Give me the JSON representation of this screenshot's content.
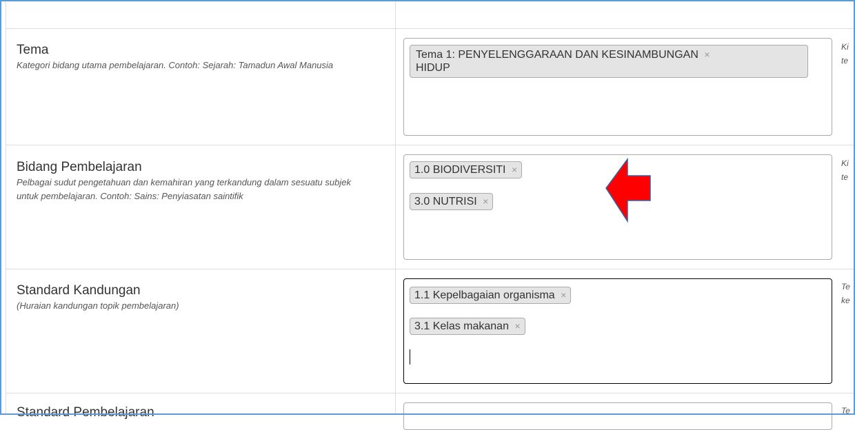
{
  "rows": [
    {
      "label": "Tema",
      "help": "Kategori bidang utama pembelajaran. Contoh: Sejarah: Tamadun Awal Manusia",
      "tags": [
        {
          "line1": "Tema 1: PENYELENGGARAAN DAN KESINAMBUNGAN",
          "line2": "HIDUP",
          "remove": "×"
        }
      ],
      "side": [
        "Ki",
        "te"
      ]
    },
    {
      "label": "Bidang Pembelajaran",
      "help": "Pelbagai sudut pengetahuan dan kemahiran yang terkandung dalam sesuatu subjek untuk pembelajaran. Contoh: Sains: Penyiasatan saintifik",
      "tags": [
        {
          "text": "1.0 BIODIVERSITI",
          "remove": "×"
        },
        {
          "text": "3.0 NUTRISI",
          "remove": "×"
        }
      ],
      "side": [
        "Ki",
        "te"
      ]
    },
    {
      "label": "Standard Kandungan",
      "help": "(Huraian kandungan topik pembelajaran)",
      "tags": [
        {
          "text": "1.1 Kepelbagaian organisma",
          "remove": "×"
        },
        {
          "text": "3.1 Kelas makanan",
          "remove": "×"
        }
      ],
      "side": [
        "Te",
        "ke"
      ]
    },
    {
      "label": "Standard Pembelajaran",
      "side": [
        "Te"
      ]
    }
  ],
  "colors": {
    "arrow": "#ff0000",
    "frame": "#5b9bd5",
    "focus_border": "#000000"
  },
  "annotation": {
    "type": "red-arrow-left-icon"
  }
}
